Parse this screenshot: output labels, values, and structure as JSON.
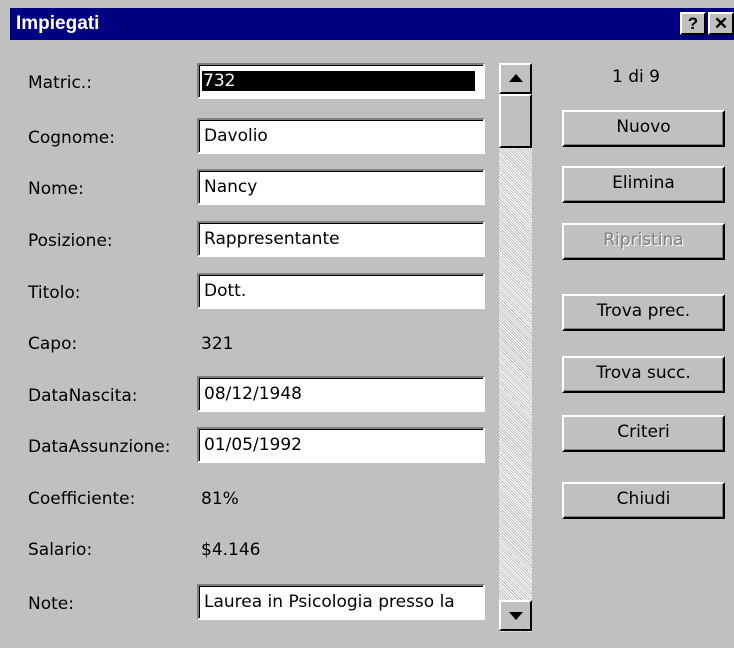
{
  "window": {
    "title": "Impiegati",
    "help_button": "?",
    "close_button": "✕"
  },
  "fields": [
    {
      "label": "Matric.:",
      "value": "732",
      "type": "input",
      "selected": true
    },
    {
      "label": "Cognome:",
      "value": "Davolio",
      "type": "input"
    },
    {
      "label": "Nome:",
      "value": "Nancy",
      "type": "input"
    },
    {
      "label": "Posizione:",
      "value": "Rappresentante",
      "type": "input"
    },
    {
      "label": "Titolo:",
      "value": "Dott.",
      "type": "input"
    },
    {
      "label": "Capo:",
      "value": "321",
      "type": "static"
    },
    {
      "label": "DataNascita:",
      "value": "08/12/1948",
      "type": "input"
    },
    {
      "label": "DataAssunzione:",
      "value": "01/05/1992",
      "type": "input"
    },
    {
      "label": "Coefficiente:",
      "value": "81%",
      "type": "static"
    },
    {
      "label": "Salario:",
      "value": "$4.146",
      "type": "static"
    },
    {
      "label": "Note:",
      "value": "Laurea in Psicologia presso la",
      "type": "input"
    }
  ],
  "record_counter": "1 di 9",
  "buttons": {
    "nuovo": "Nuovo",
    "elimina": "Elimina",
    "ripristina": "Ripristina",
    "trova_prec": "Trova prec.",
    "trova_succ": "Trova succ.",
    "criteri": "Criteri",
    "chiudi": "Chiudi"
  },
  "scroll_position": 0,
  "colors": {
    "titlebar": "#000080",
    "dialog_face": "#c0c0c0",
    "disabled_text": "#808080"
  }
}
